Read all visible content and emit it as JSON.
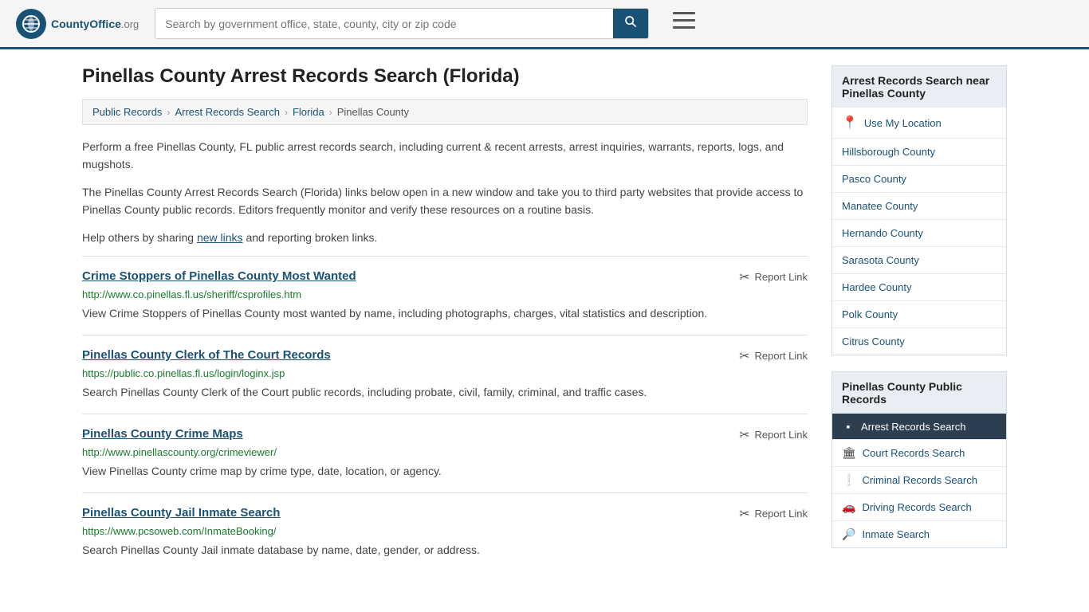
{
  "header": {
    "logo_text": "CountyOffice",
    "logo_suffix": ".org",
    "search_placeholder": "Search by government office, state, county, city or zip code",
    "search_button_label": "🔍"
  },
  "page": {
    "title": "Pinellas County Arrest Records Search (Florida)",
    "breadcrumbs": [
      {
        "label": "Public Records",
        "url": "#"
      },
      {
        "label": "Arrest Records Search",
        "url": "#"
      },
      {
        "label": "Florida",
        "url": "#"
      },
      {
        "label": "Pinellas County",
        "url": null
      }
    ],
    "description1": "Perform a free Pinellas County, FL public arrest records search, including current & recent arrests, arrest inquiries, warrants, reports, logs, and mugshots.",
    "description2": "The Pinellas County Arrest Records Search (Florida) links below open in a new window and take you to third party websites that provide access to Pinellas County public records. Editors frequently monitor and verify these resources on a routine basis.",
    "description3_prefix": "Help others by sharing ",
    "new_links_text": "new links",
    "description3_suffix": " and reporting broken links."
  },
  "results": [
    {
      "title": "Crime Stoppers of Pinellas County Most Wanted",
      "url": "http://www.co.pinellas.fl.us/sheriff/csprofiles.htm",
      "url_color": "green",
      "description": "View Crime Stoppers of Pinellas County most wanted by name, including photographs, charges, vital statistics and description.",
      "report_label": "Report Link"
    },
    {
      "title": "Pinellas County Clerk of The Court Records",
      "url": "https://public.co.pinellas.fl.us/login/loginx.jsp",
      "url_color": "green",
      "description": "Search Pinellas County Clerk of the Court public records, including probate, civil, family, criminal, and traffic cases.",
      "report_label": "Report Link"
    },
    {
      "title": "Pinellas County Crime Maps",
      "url": "http://www.pinellascounty.org/crimeviewer/",
      "url_color": "green",
      "description": "View Pinellas County crime map by crime type, date, location, or agency.",
      "report_label": "Report Link"
    },
    {
      "title": "Pinellas County Jail Inmate Search",
      "url": "https://www.pcsoweb.com/InmateBooking/",
      "url_color": "green",
      "description": "Search Pinellas County Jail inmate database by name, date, gender, or address.",
      "report_label": "Report Link"
    }
  ],
  "sidebar": {
    "nearby_title": "Arrest Records Search near Pinellas County",
    "use_location_label": "Use My Location",
    "nearby_counties": [
      {
        "name": "Hillsborough County"
      },
      {
        "name": "Pasco County"
      },
      {
        "name": "Manatee County"
      },
      {
        "name": "Hernando County"
      },
      {
        "name": "Sarasota County"
      },
      {
        "name": "Hardee County"
      },
      {
        "name": "Polk County"
      },
      {
        "name": "Citrus County"
      }
    ],
    "public_records_title": "Pinellas County Public Records",
    "public_records_links": [
      {
        "label": "Arrest Records Search",
        "icon": "▪",
        "active": true
      },
      {
        "label": "Court Records Search",
        "icon": "🏛",
        "active": false
      },
      {
        "label": "Criminal Records Search",
        "icon": "❕",
        "active": false
      },
      {
        "label": "Driving Records Search",
        "icon": "🚗",
        "active": false
      },
      {
        "label": "Inmate Search",
        "icon": "🔎",
        "active": false
      }
    ]
  }
}
